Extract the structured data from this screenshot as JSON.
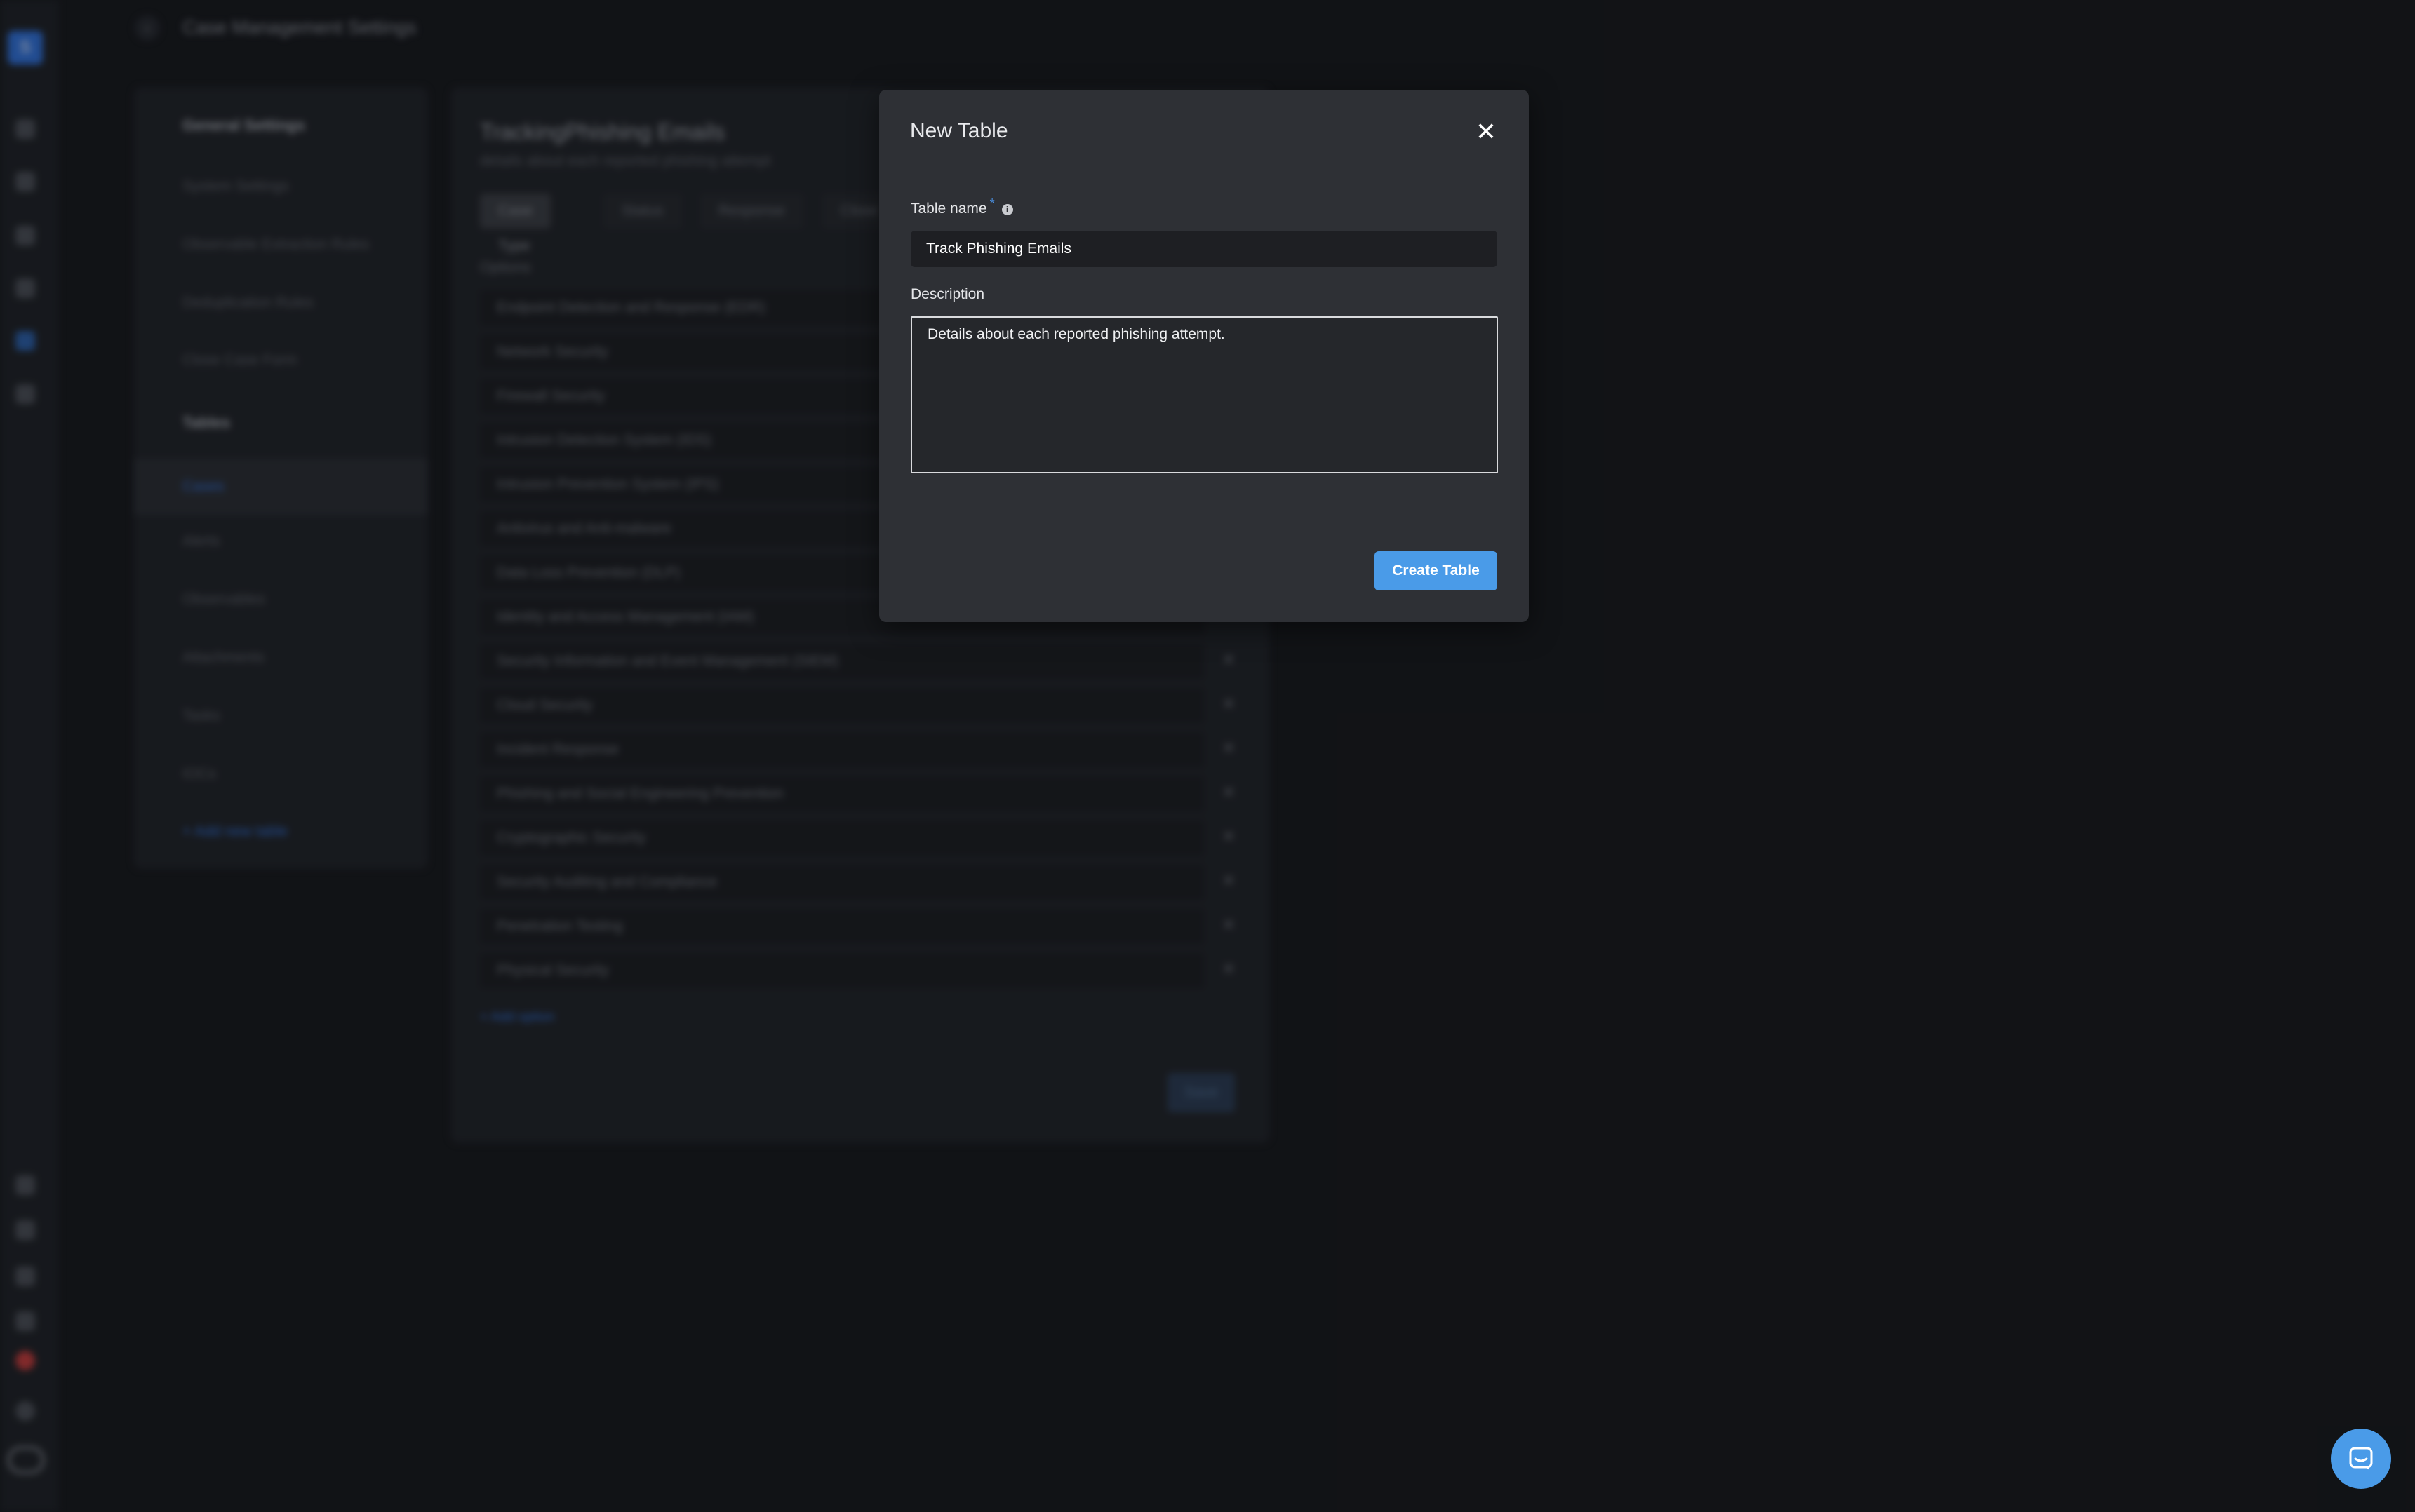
{
  "header": {
    "title": "Case Management Settings"
  },
  "settings_nav": {
    "general_heading": "General Settings",
    "general_items": [
      "System Settings",
      "Observable Extraction Rules",
      "Deduplication Rules",
      "Close Case Form"
    ],
    "tables_heading": "Tables",
    "table_items": [
      "Cases",
      "Alerts",
      "Observables",
      "Attachments",
      "Tasks",
      "IOCs"
    ],
    "add_table": "+ Add new table"
  },
  "panel": {
    "title": "TrackingPhishing Emails",
    "subtitle": "details about each reported phishing attempt",
    "tabs": [
      "Case Type",
      "Status",
      "Response",
      "Close"
    ],
    "options_label": "Options",
    "options": [
      "Endpoint Detection and Response (EDR)",
      "Network Security",
      "Firewall Security",
      "Intrusion Detection System (IDS)",
      "Intrusion Prevention System (IPS)",
      "Antivirus and Anti-malware",
      "Data Loss Prevention (DLP)",
      "Identity and Access Management (IAM)",
      "Security Information and Event Management (SIEM)",
      "Cloud Security",
      "Incident Response",
      "Phishing and Social Engineering Prevention",
      "Cryptographic Security",
      "Security Auditing and Compliance",
      "Penetration Testing",
      "Physical Security"
    ],
    "remove_glyph": "✕",
    "add_option": "+ Add option",
    "save_label": "Save"
  },
  "modal": {
    "title": "New Table",
    "close_glyph": "✕",
    "table_name_label": "Table name",
    "required_mark": "*",
    "info_glyph": "i",
    "table_name_value": "Track Phishing Emails",
    "description_label": "Description",
    "description_value": "Details about each reported phishing attempt.",
    "create_label": "Create Table"
  },
  "rail": {
    "logo_letter": "S"
  },
  "colors": {
    "accent": "#4a9be8",
    "background": "#16171b",
    "modal": "#2e3035"
  },
  "icons": [
    "back-arrow-icon",
    "close-icon",
    "info-icon",
    "chat-icon"
  ]
}
